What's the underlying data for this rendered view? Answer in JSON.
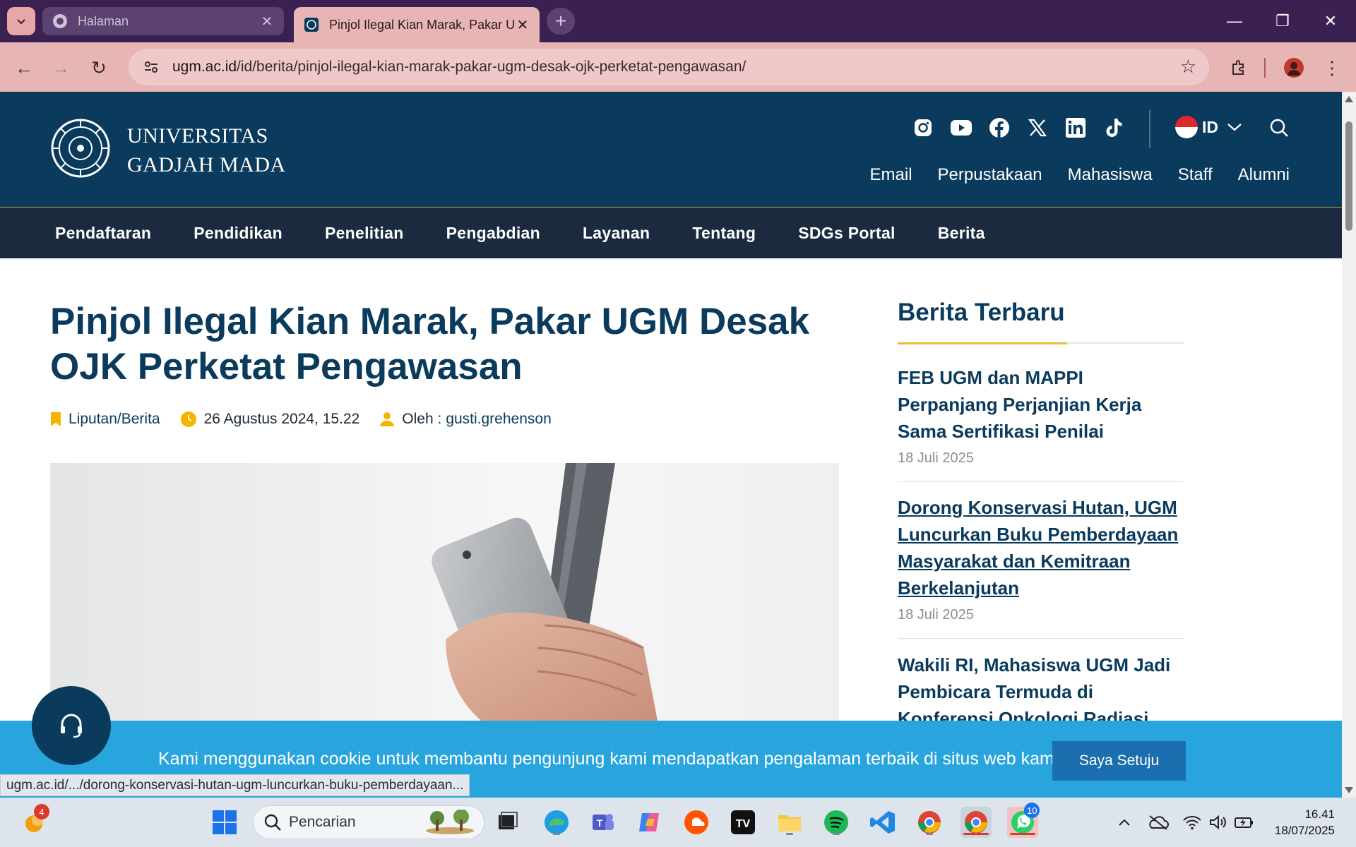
{
  "browser": {
    "tabs": [
      {
        "title": "Halaman",
        "active": false
      },
      {
        "title": "Pinjol Ilegal Kian Marak, Pakar UGM Desak OJK Perketat Pengawasan",
        "active": true
      }
    ],
    "url_host": "ugm.ac.id",
    "url_path": "/id/berita/pinjol-ilegal-kian-marak-pakar-ugm-desak-ojk-perketat-pengawasan/",
    "status_url": "ugm.ac.id/.../dorong-konservasi-hutan-ugm-luncurkan-buku-pemberdayaan..."
  },
  "site": {
    "logo_line1": "UNIVERSITAS",
    "logo_line2": "GADJAH MADA",
    "lang": "ID",
    "social_icons": [
      "instagram-icon",
      "youtube-icon",
      "facebook-icon",
      "x-icon",
      "linkedin-icon",
      "tiktok-icon"
    ],
    "quicklinks": [
      "Email",
      "Perpustakaan",
      "Mahasiswa",
      "Staff",
      "Alumni"
    ],
    "nav": [
      "Pendaftaran",
      "Pendidikan",
      "Penelitian",
      "Pengabdian",
      "Layanan",
      "Tentang",
      "SDGs Portal",
      "Berita"
    ]
  },
  "article": {
    "title": "Pinjol Ilegal Kian Marak, Pakar UGM Desak OJK Perketat Pengawasan",
    "category": "Liputan/Berita",
    "date": "26 Agustus 2024, 15.22",
    "author_prefix": "Oleh :",
    "author": "gusti.grehenson"
  },
  "sidebar": {
    "title": "Berita Terbaru",
    "items": [
      {
        "title": "FEB UGM dan MAPPI Perpanjang Perjanjian Kerja Sama Sertifikasi Penilai",
        "date": "18 Juli 2025"
      },
      {
        "title": "Dorong Konservasi Hutan, UGM Luncurkan Buku Pemberdayaan Masyarakat dan Kemitraan Berkelanjutan",
        "date": "18 Juli 2025"
      },
      {
        "title": "Wakili RI, Mahasiswa UGM Jadi Pembicara Termuda di Konferensi Onkologi Radiasi",
        "date": ""
      }
    ]
  },
  "cookie": {
    "message": "Kami menggunakan cookie untuk membantu pengunjung kami mendapatkan pengalaman terbaik di situs web kami.",
    "button": "Saya Setuju"
  },
  "taskbar": {
    "search_placeholder": "Pencarian",
    "weather_badge": "4",
    "whatsapp_badge": "10",
    "time": "16.41",
    "date": "18/07/2025"
  },
  "colors": {
    "brand_navy": "#0a3a5c",
    "nav_dark": "#1b2a3e",
    "accent_gold": "#e8b93a",
    "cookie_blue": "#29a5dd"
  }
}
